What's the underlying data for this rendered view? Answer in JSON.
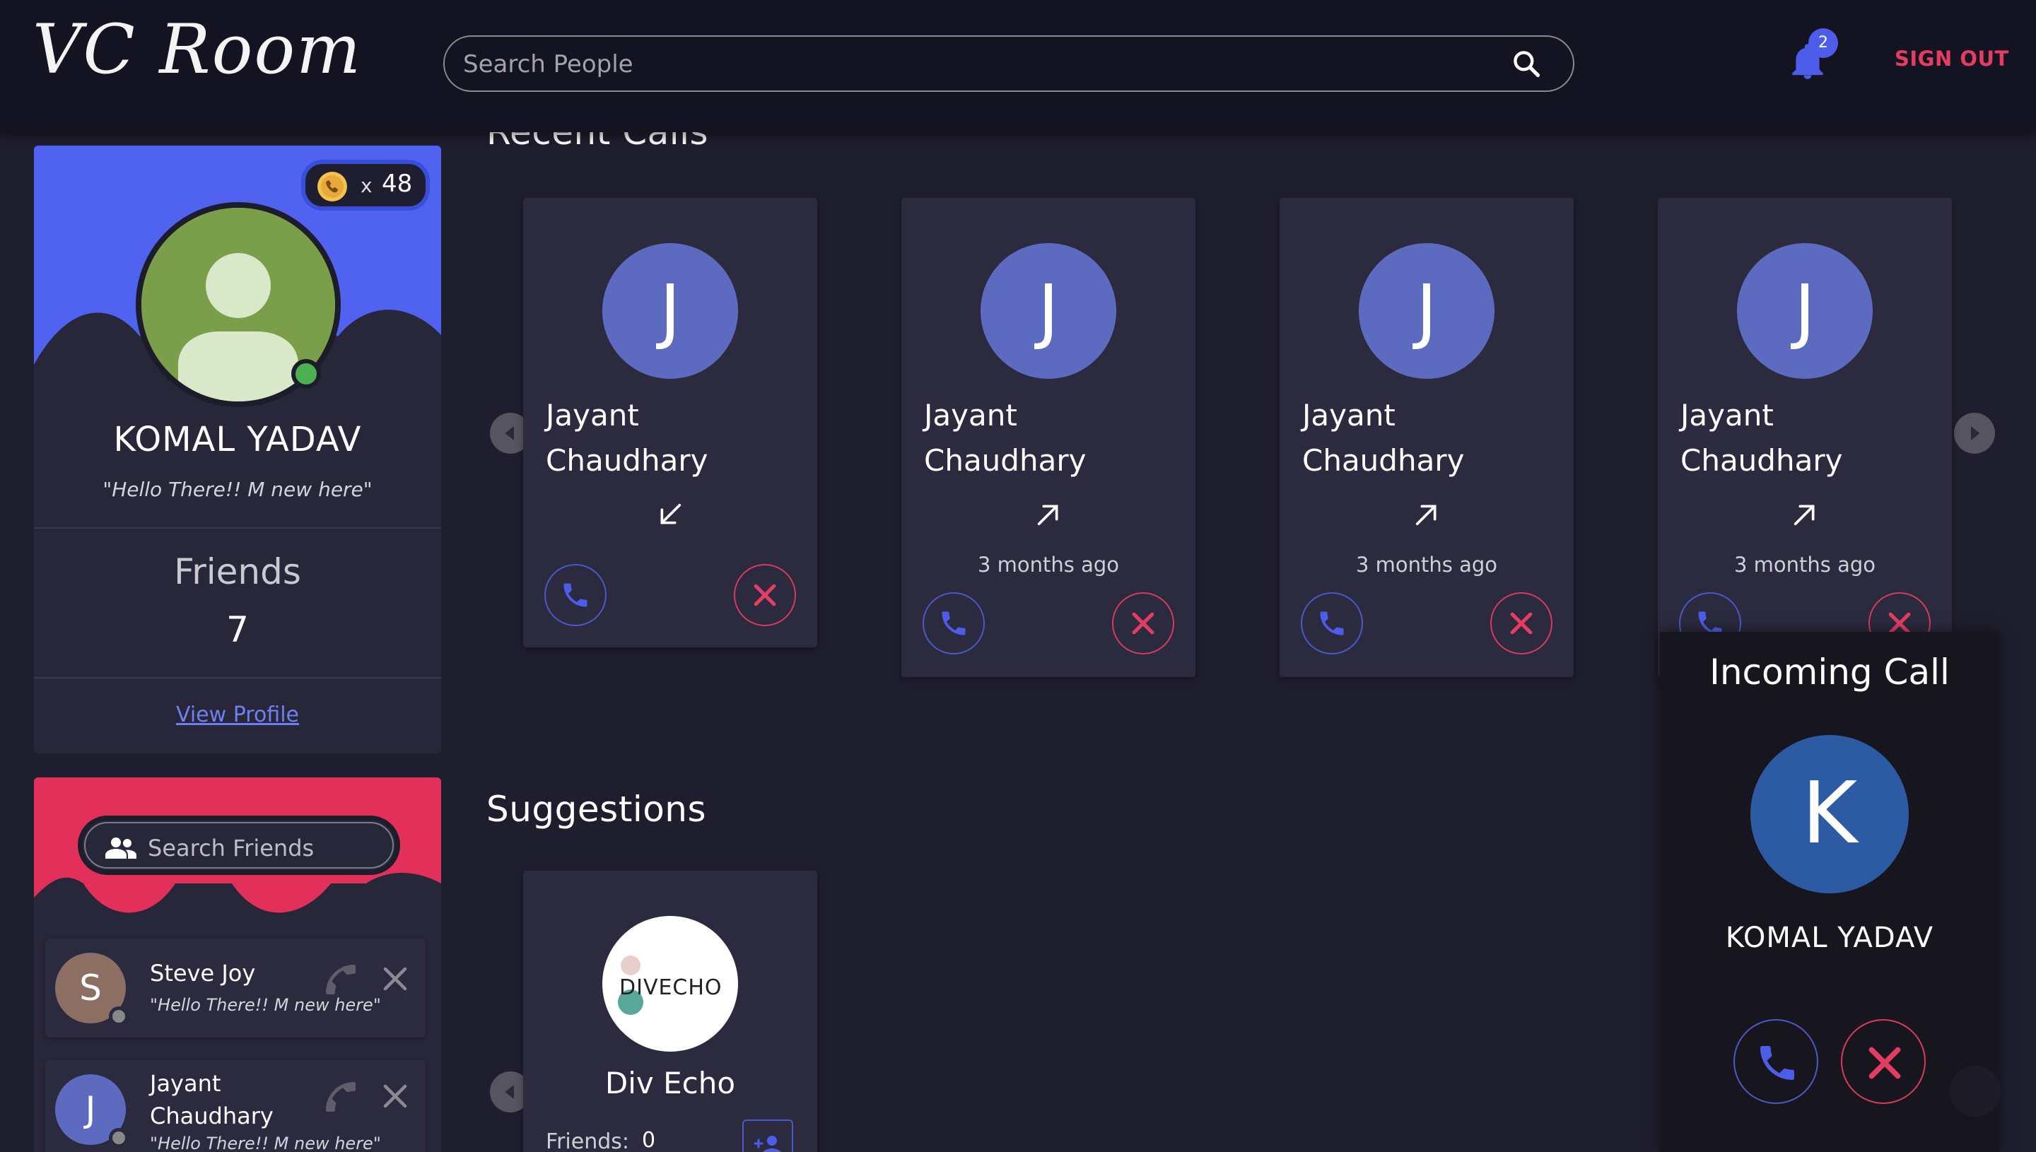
{
  "header": {
    "logo": "VC Room",
    "search_placeholder": "Search People",
    "notification_count": "2",
    "sign_out": "SIGN OUT"
  },
  "profile": {
    "coins_x": "x",
    "coins": "48",
    "name": "KOMAL YADAV",
    "status": "\"Hello There!! M new here\"",
    "friends_label": "Friends",
    "friends_count": "7",
    "view_profile": "View Profile"
  },
  "friends_panel": {
    "search_placeholder": "Search Friends",
    "items": [
      {
        "initial": "S",
        "name": "Steve Joy",
        "status": "\"Hello There!! M new here\"",
        "avatar_color": "#8d6e63"
      },
      {
        "initial": "J",
        "name": "Jayant Chaudhary",
        "status": "\"Hello There!! M new here\"",
        "avatar_color": "#5c6bc0"
      }
    ]
  },
  "recent_calls": {
    "title": "Recent Calls",
    "cards": [
      {
        "initial": "J",
        "name": "Jayant Chaudhary",
        "direction": "incoming",
        "time": ""
      },
      {
        "initial": "J",
        "name": "Jayant Chaudhary",
        "direction": "outgoing",
        "time": "3 months ago"
      },
      {
        "initial": "J",
        "name": "Jayant Chaudhary",
        "direction": "outgoing",
        "time": "3 months ago"
      },
      {
        "initial": "J",
        "name": "Jayant Chaudhary",
        "direction": "outgoing",
        "time": "3 months ago"
      }
    ]
  },
  "suggestions": {
    "title": "Suggestions",
    "cards": [
      {
        "logo_text": "DIVECHO",
        "name": "Div Echo",
        "friends_label": "Friends:",
        "friends_count": "0"
      }
    ]
  },
  "incoming_call": {
    "title": "Incoming Call",
    "initial": "K",
    "name": "KOMAL YADAV"
  },
  "colors": {
    "background": "#1f1e2e",
    "header": "#141321",
    "card": "#2b2a3e",
    "accent_blue": "#4e5de9",
    "accent_red": "#e43d63"
  }
}
